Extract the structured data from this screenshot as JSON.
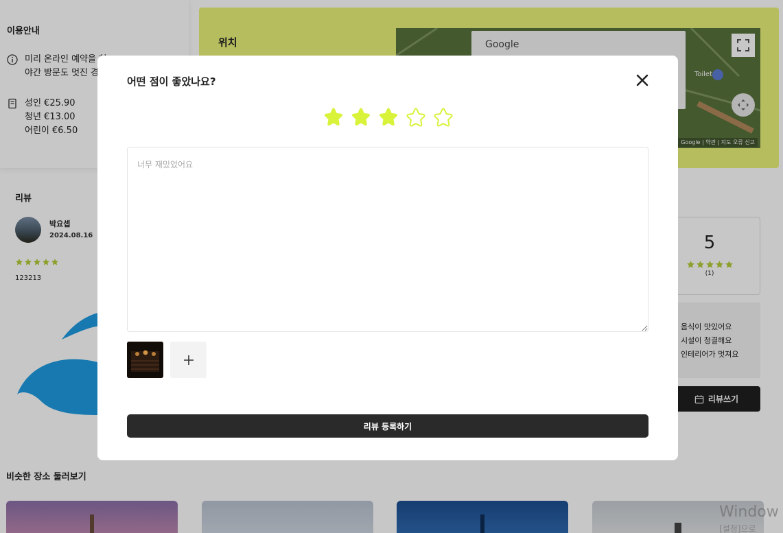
{
  "info": {
    "title": "이용안내",
    "notice_line1": "미리 온라인 예약을 하",
    "notice_line2": "야간 방문도 멋진 경험",
    "prices": [
      "성인 €25.90",
      "청년 €13.00",
      "어린이 €6.50"
    ]
  },
  "location": {
    "title": "위치",
    "map_search_text": "Google",
    "map_poi_label": "Toilet",
    "map_credits": "Google  |  약관  |  지도 오류 신고"
  },
  "reviews": {
    "title": "리뷰",
    "items": [
      {
        "name": "박요셉",
        "date": "2024.08.16",
        "rating": 5,
        "text": "123213"
      }
    ]
  },
  "summary": {
    "score": "5",
    "rating": 5,
    "count": "(1)",
    "tags": [
      "음식이 맛있어요",
      "시설이 청결해요",
      "인테리어가 멋져요"
    ],
    "write_button": "리뷰쓰기"
  },
  "similar": {
    "title": "비슷한 장소 둘러보기"
  },
  "watermark": {
    "line1": "Window",
    "line2": "[설정]으로"
  },
  "modal": {
    "title": "어떤 점이 좋았나요?",
    "rating": 3,
    "max_rating": 5,
    "textarea_placeholder": "너무 재밌었어요",
    "textarea_value": "",
    "submit_label": "리뷰 등록하기"
  },
  "colors": {
    "accent": "#d9f23a",
    "accent_dim": "#b4cf3a",
    "dark": "#2a2a2a",
    "location_bg": "#eaf27a"
  }
}
